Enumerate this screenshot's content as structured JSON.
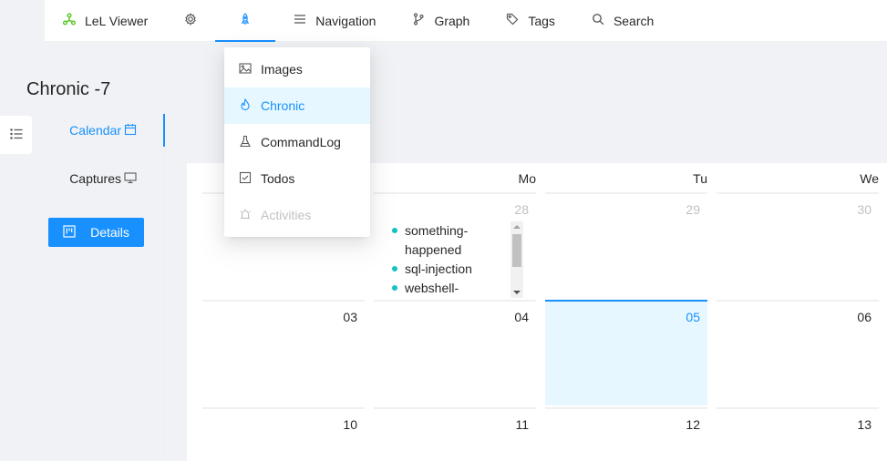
{
  "nav": {
    "brand_label": "LeL Viewer",
    "items": [
      {
        "label": "Navigation"
      },
      {
        "label": "Graph"
      },
      {
        "label": "Tags"
      },
      {
        "label": "Search"
      }
    ]
  },
  "dropdown": {
    "items": [
      {
        "label": "Images",
        "icon": "image-icon"
      },
      {
        "label": "Chronic",
        "icon": "fire-icon",
        "selected": true
      },
      {
        "label": "CommandLog",
        "icon": "experiment-icon"
      },
      {
        "label": "Todos",
        "icon": "checkbox-icon"
      },
      {
        "label": "Activities",
        "icon": "alert-icon",
        "disabled": true
      }
    ]
  },
  "page": {
    "title": "Chronic -7"
  },
  "tabs": [
    {
      "label": "Calendar",
      "icon": "calendar-icon",
      "active": true
    },
    {
      "label": "Captures",
      "icon": "desktop-icon",
      "active": false
    }
  ],
  "details_button": {
    "label": "Details",
    "icon": "project-icon"
  },
  "calendar": {
    "weekdays": [
      "Mo",
      "Tu",
      "We"
    ],
    "rows": [
      [
        "28",
        "29",
        "30"
      ],
      [
        "03",
        "04",
        "05",
        "06"
      ],
      [
        "10",
        "11",
        "12",
        "13"
      ]
    ],
    "events": [
      "something-happened",
      "sql-injection",
      "webshell-"
    ]
  },
  "colors": {
    "primary": "#1890ff",
    "selected_bg": "#e6f7ff",
    "event_dot": "#13c2c2",
    "brand_icon": "#52c41a"
  }
}
